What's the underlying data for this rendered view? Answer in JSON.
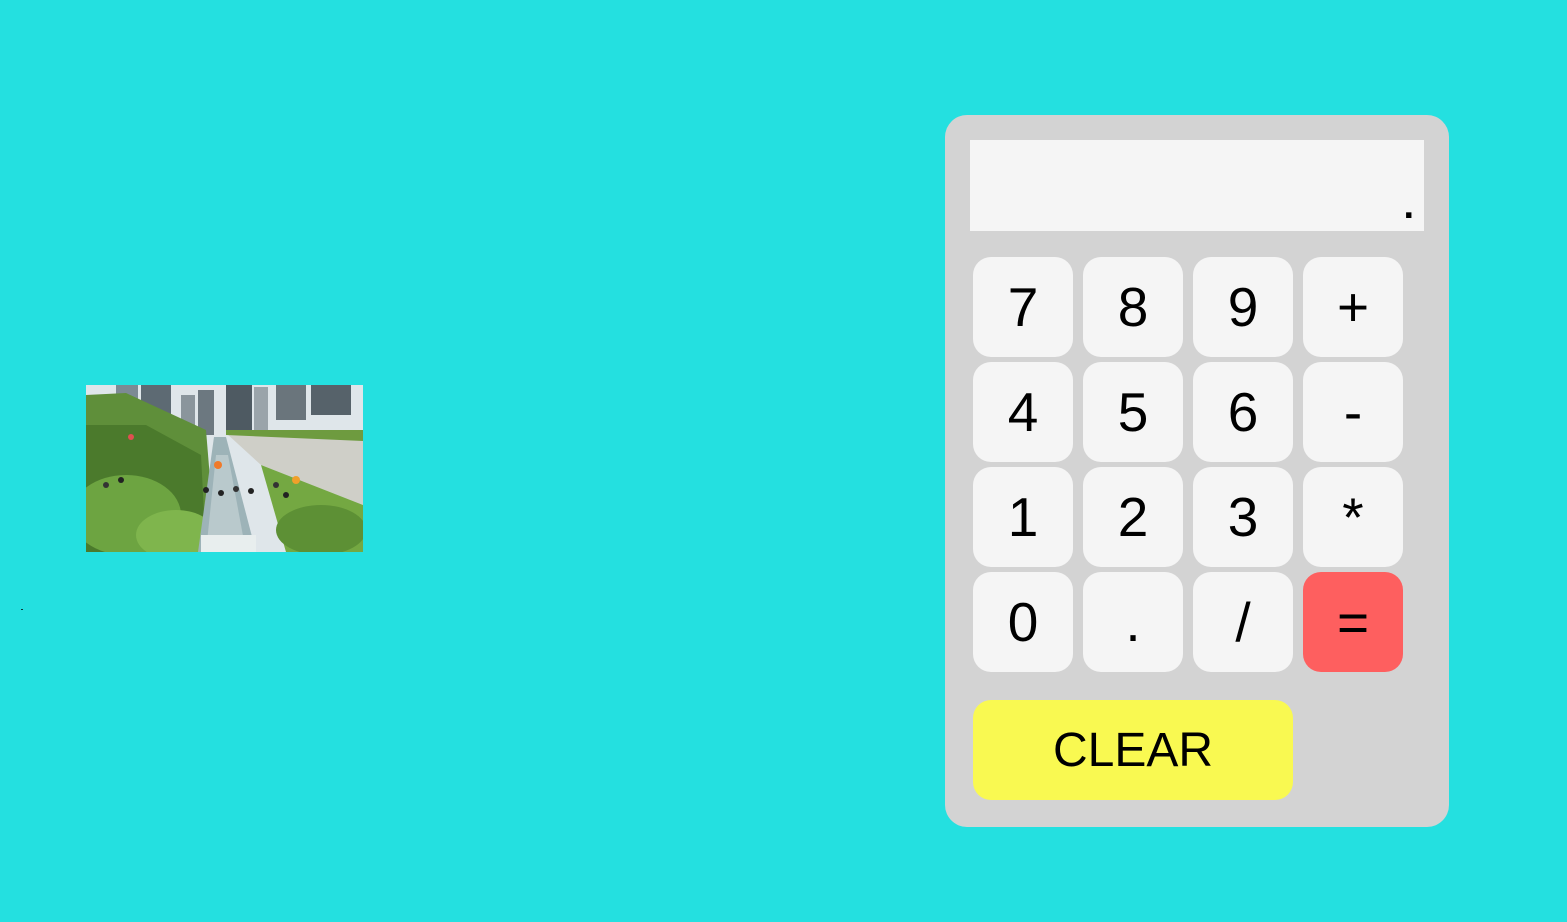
{
  "photo": {
    "alt": "city stream park"
  },
  "calculator": {
    "display_value": ".",
    "keys": [
      {
        "label": "7",
        "name": "key-7"
      },
      {
        "label": "8",
        "name": "key-8"
      },
      {
        "label": "9",
        "name": "key-9"
      },
      {
        "label": "+",
        "name": "key-plus"
      },
      {
        "label": "4",
        "name": "key-4"
      },
      {
        "label": "5",
        "name": "key-5"
      },
      {
        "label": "6",
        "name": "key-6"
      },
      {
        "label": "-",
        "name": "key-minus"
      },
      {
        "label": "1",
        "name": "key-1"
      },
      {
        "label": "2",
        "name": "key-2"
      },
      {
        "label": "3",
        "name": "key-3"
      },
      {
        "label": "*",
        "name": "key-multiply"
      },
      {
        "label": "0",
        "name": "key-0"
      },
      {
        "label": ".",
        "name": "key-decimal"
      },
      {
        "label": "/",
        "name": "key-divide"
      },
      {
        "label": "=",
        "name": "key-equals"
      }
    ],
    "clear_label": "CLEAR"
  },
  "colors": {
    "page_background": "#24e0e0",
    "calculator_body": "#d3d3d3",
    "key_background": "#f5f5f5",
    "equals_key": "#fe5f5f",
    "clear_key": "#f9f951"
  }
}
